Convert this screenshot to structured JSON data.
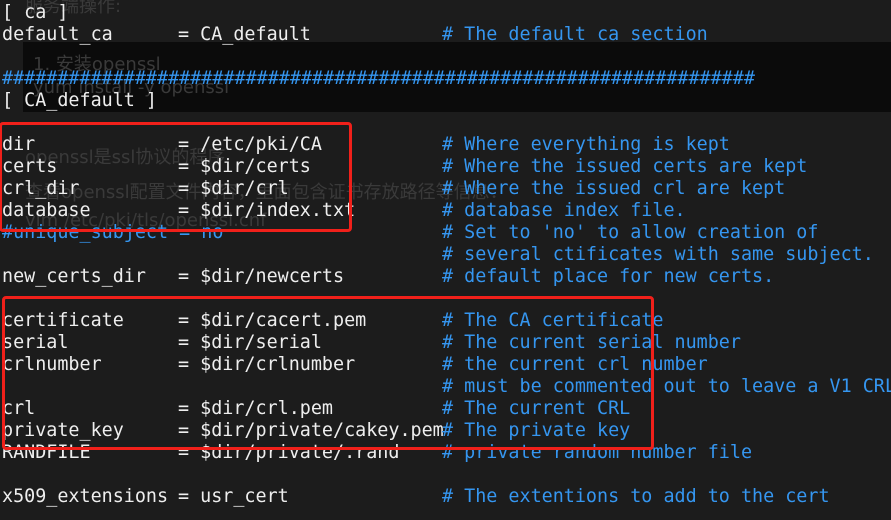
{
  "background_ghost_text": [
    "服务端操作:",
    "1. 安装openssl",
    "yum install -y openssl",
    "openssl是ssl协议的程序",
    "查看openssl配置文件内容，里面包含证书存放路径等信息：",
    "vim /etc/pki/tls/openssl.cnf"
  ],
  "colors": {
    "text": "#eeeeee",
    "comment": "#3596f0",
    "highlight_box": "#f0201a",
    "background": "#1c1c1c"
  },
  "lines": [
    {
      "key": "[ ca ]",
      "value": "",
      "comment": ""
    },
    {
      "key": "default_ca",
      "value": "= CA_default",
      "comment": "# The default ca section"
    },
    {
      "key": "",
      "value": "",
      "comment": ""
    },
    {
      "key": "####################################################################",
      "value": "",
      "comment": "",
      "style": "blue"
    },
    {
      "key": "[ CA_default ]",
      "value": "",
      "comment": ""
    },
    {
      "key": "",
      "value": "",
      "comment": ""
    },
    {
      "key": "dir",
      "value": "= /etc/pki/CA",
      "comment": "# Where everything is kept"
    },
    {
      "key": "certs",
      "value": "= $dir/certs",
      "comment": "# Where the issued certs are kept"
    },
    {
      "key": "crl_dir",
      "value": "= $dir/crl",
      "comment": "# Where the issued crl are kept"
    },
    {
      "key": "database",
      "value": "= $dir/index.txt",
      "comment": "# database index file."
    },
    {
      "key": "#unique_subject = no",
      "value": "",
      "comment": "# Set to 'no' to allow creation of",
      "style": "blue"
    },
    {
      "key": "",
      "value": "",
      "comment": "# several ctificates with same subject."
    },
    {
      "key": "new_certs_dir",
      "value": "= $dir/newcerts",
      "comment": "# default place for new certs."
    },
    {
      "key": "",
      "value": "",
      "comment": ""
    },
    {
      "key": "certificate",
      "value": "= $dir/cacert.pem",
      "comment": "# The CA certificate"
    },
    {
      "key": "serial",
      "value": "= $dir/serial",
      "comment": "# The current serial number"
    },
    {
      "key": "crlnumber",
      "value": "= $dir/crlnumber",
      "comment": "# the current crl number"
    },
    {
      "key": "",
      "value": "",
      "comment": "# must be commented out to leave a V1 CRL"
    },
    {
      "key": "crl",
      "value": "= $dir/crl.pem",
      "comment": "# The current CRL"
    },
    {
      "key": "private_key",
      "value": "= $dir/private/cakey.pem",
      "comment": "# The private key"
    },
    {
      "key": "RANDFILE",
      "value": "= $dir/private/.rand",
      "comment": "# private random number file"
    },
    {
      "key": "",
      "value": "",
      "comment": ""
    },
    {
      "key": "x509_extensions",
      "value": "= usr_cert",
      "comment": "# The extentions to add to the cert"
    }
  ]
}
